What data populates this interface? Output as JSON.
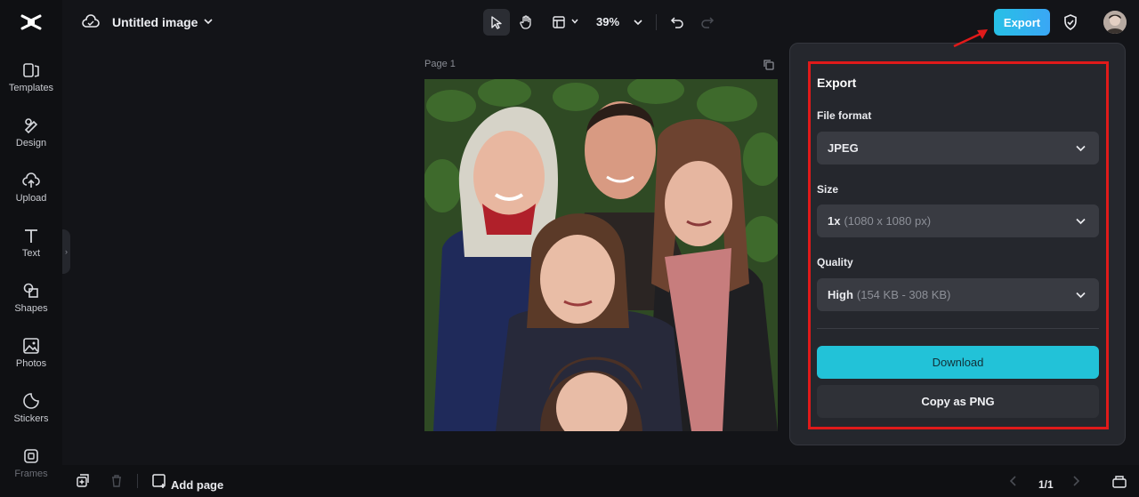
{
  "document": {
    "title": "Untitled image"
  },
  "rail": {
    "items": [
      {
        "label": "Templates",
        "icon": "templates-icon"
      },
      {
        "label": "Design",
        "icon": "design-icon"
      },
      {
        "label": "Upload",
        "icon": "upload-icon"
      },
      {
        "label": "Text",
        "icon": "text-icon"
      },
      {
        "label": "Shapes",
        "icon": "shapes-icon"
      },
      {
        "label": "Photos",
        "icon": "photos-icon"
      },
      {
        "label": "Stickers",
        "icon": "stickers-icon"
      },
      {
        "label": "Frames",
        "icon": "frames-icon"
      }
    ]
  },
  "toolbar": {
    "zoom": "39%",
    "export_label": "Export"
  },
  "canvas": {
    "page_label": "Page 1"
  },
  "export_panel": {
    "title": "Export",
    "file_format": {
      "label": "File format",
      "value": "JPEG"
    },
    "size": {
      "label": "Size",
      "value": "1x",
      "detail": "(1080 x 1080 px)"
    },
    "quality": {
      "label": "Quality",
      "value": "High",
      "detail": "(154 KB - 308 KB)"
    },
    "download_label": "Download",
    "copy_label": "Copy as PNG"
  },
  "bottom": {
    "add_page_label": "Add page",
    "pager": "1/1"
  },
  "colors": {
    "accent": "#22c2d8",
    "highlight": "#e01a1a",
    "panel": "#25272d",
    "background": "#131418"
  }
}
